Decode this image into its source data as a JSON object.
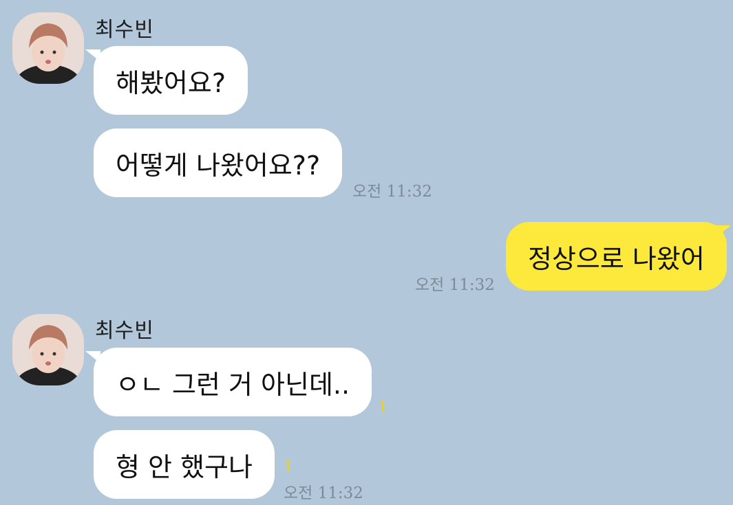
{
  "chat": {
    "messages": [
      {
        "sender": "최수빈",
        "bubbles": [
          {
            "text": "해봤어요?"
          },
          {
            "text": "어떻게 나왔어요??",
            "time": "오전 11:32"
          }
        ]
      },
      {
        "sender": "me",
        "bubbles": [
          {
            "text": "정상으로 나왔어",
            "time": "오전 11:32"
          }
        ]
      },
      {
        "sender": "최수빈",
        "bubbles": [
          {
            "text": "ㅇㄴ 그런 거 아닌데..",
            "unread": "1"
          },
          {
            "text": "형 안 했구나",
            "unread": "1",
            "time": "오전 11:32"
          }
        ]
      }
    ]
  },
  "colors": {
    "background": "#b2c7d9",
    "incoming_bubble": "#ffffff",
    "outgoing_bubble": "#fde83c",
    "unread_count": "#f2d400",
    "timestamp": "#7d8b98"
  },
  "icons": {
    "avatar": "profile-photo"
  }
}
